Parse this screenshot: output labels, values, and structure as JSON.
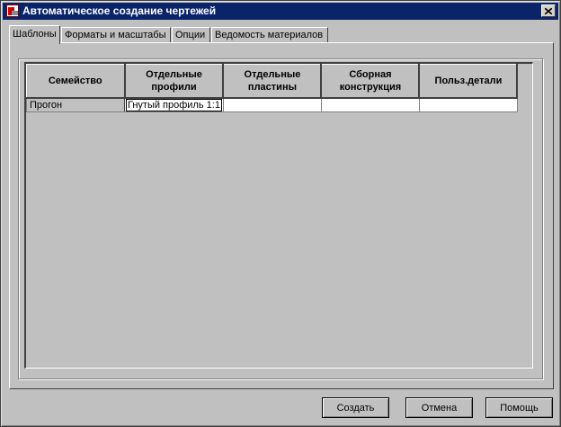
{
  "window": {
    "title": "Автоматическое создание чертежей"
  },
  "tabs": [
    {
      "label": "Шаблоны",
      "active": true
    },
    {
      "label": "Форматы и масштабы",
      "active": false
    },
    {
      "label": "Опции",
      "active": false
    },
    {
      "label": "Ведомость материалов",
      "active": false
    }
  ],
  "table": {
    "columns": [
      "Семейство",
      "Отдельные профили",
      "Отдельные пластины",
      "Сборная конструкция",
      "Польз.детали"
    ],
    "rows": [
      {
        "family": "Прогон",
        "cells": [
          "Гнутый профиль 1:1",
          "",
          "",
          ""
        ]
      }
    ]
  },
  "buttons": {
    "create": "Создать",
    "cancel": "Отмена",
    "help": "Помощь"
  },
  "icons": {
    "close": "close-icon",
    "app": "app-icon"
  }
}
